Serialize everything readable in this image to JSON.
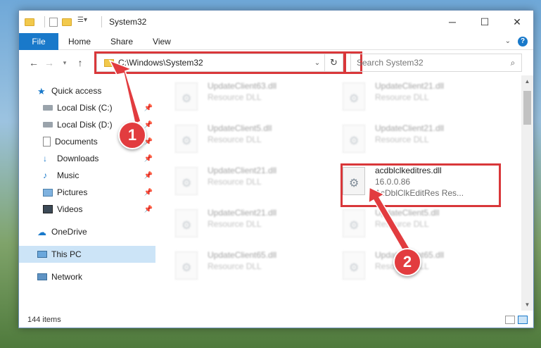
{
  "window": {
    "title": "System32",
    "controls": {
      "minimize": "─",
      "maximize": "☐",
      "close": "✕"
    }
  },
  "ribbon": {
    "tabs": [
      "File",
      "Home",
      "Share",
      "View"
    ],
    "help": "?"
  },
  "address": {
    "path": "C:\\Windows\\System32",
    "search_placeholder": "Search System32"
  },
  "sidebar": {
    "items": [
      {
        "label": "Quick access",
        "icon": "star-icon"
      },
      {
        "label": "Local Disk (C:)",
        "icon": "drive-icon"
      },
      {
        "label": "Local Disk (D:)",
        "icon": "drive-icon"
      },
      {
        "label": "Documents",
        "icon": "documents-icon"
      },
      {
        "label": "Downloads",
        "icon": "download-icon"
      },
      {
        "label": "Music",
        "icon": "music-icon"
      },
      {
        "label": "Pictures",
        "icon": "pictures-icon"
      },
      {
        "label": "Videos",
        "icon": "videos-icon"
      },
      {
        "label": "OneDrive",
        "icon": "cloud-icon"
      },
      {
        "label": "This PC",
        "icon": "computer-icon"
      },
      {
        "label": "Network",
        "icon": "network-icon"
      }
    ]
  },
  "files": [
    {
      "name": "UpdateClient63.dll",
      "line1": "Resource DLL",
      "line2": ""
    },
    {
      "name": "UpdateClient21.dll",
      "line1": "Resource DLL",
      "line2": ""
    },
    {
      "name": "UpdateClient5.dll",
      "line1": "Resource DLL",
      "line2": ""
    },
    {
      "name": "UpdateClient21.dll",
      "line1": "Resource DLL",
      "line2": ""
    },
    {
      "name": "UpdateClient21.dll",
      "line1": "Resource DLL",
      "line2": ""
    },
    {
      "name": "acdblclkeditres.dll",
      "line1": "16.0.0.86",
      "line2": "AcDblClkEditRes Res..."
    },
    {
      "name": "UpdateClient21.dll",
      "line1": "Resource DLL",
      "line2": ""
    },
    {
      "name": "UpdateClient5.dll",
      "line1": "Resource DLL",
      "line2": ""
    },
    {
      "name": "UpdateClient65.dll",
      "line1": "Resource DLL",
      "line2": ""
    },
    {
      "name": "UpdateClient65.dll",
      "line1": "Resource DLL",
      "line2": ""
    }
  ],
  "status": {
    "count": "144 items"
  },
  "annotations": {
    "step1": "1",
    "step2": "2"
  },
  "colors": {
    "accent": "#1979ca",
    "highlight": "#d9373a",
    "selection": "#cce4f7"
  }
}
